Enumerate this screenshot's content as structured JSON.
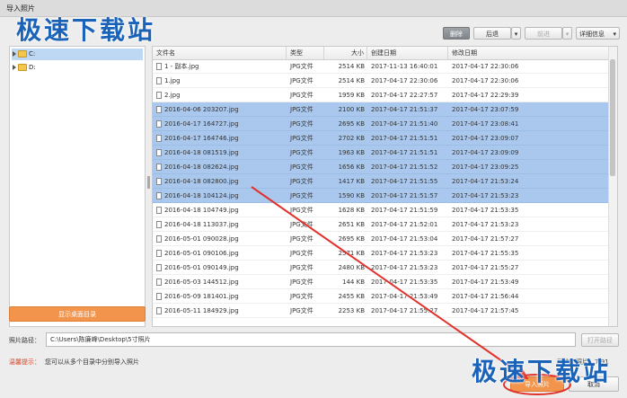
{
  "window": {
    "title": "导入照片"
  },
  "watermark": {
    "text": "极速下载站"
  },
  "toolbar": {
    "delete_label": "删除",
    "back_label": "后退",
    "forward_label": "前进",
    "details_label": "详细信息"
  },
  "tree": {
    "items": [
      {
        "label": "C:",
        "selected": true
      },
      {
        "label": "D:",
        "selected": false
      }
    ],
    "show_desktop_label": "显示桌面目录"
  },
  "table": {
    "columns": [
      "文件名",
      "类型",
      "大小",
      "创建日期",
      "修改日期"
    ],
    "rows": [
      {
        "name": "1 - 副本.jpg",
        "type": "JPG文件",
        "size": "2514 KB",
        "created": "2017-11-13 16:40:01",
        "modified": "2017-04-17 22:30:06",
        "selected": false
      },
      {
        "name": "1.jpg",
        "type": "JPG文件",
        "size": "2514 KB",
        "created": "2017-04-17 22:30:06",
        "modified": "2017-04-17 22:30:06",
        "selected": false
      },
      {
        "name": "2.jpg",
        "type": "JPG文件",
        "size": "1959 KB",
        "created": "2017-04-17 22:27:57",
        "modified": "2017-04-17 22:29:39",
        "selected": false
      },
      {
        "name": "2016-04-06 203207.jpg",
        "type": "JPG文件",
        "size": "2100 KB",
        "created": "2017-04-17 21:51:37",
        "modified": "2017-04-17 23:07:59",
        "selected": true
      },
      {
        "name": "2016-04-17 164727.jpg",
        "type": "JPG文件",
        "size": "2695 KB",
        "created": "2017-04-17 21:51:40",
        "modified": "2017-04-17 23:08:41",
        "selected": true
      },
      {
        "name": "2016-04-17 164746.jpg",
        "type": "JPG文件",
        "size": "2702 KB",
        "created": "2017-04-17 21:51:51",
        "modified": "2017-04-17 23:09:07",
        "selected": true
      },
      {
        "name": "2016-04-18 081519.jpg",
        "type": "JPG文件",
        "size": "1963 KB",
        "created": "2017-04-17 21:51:51",
        "modified": "2017-04-17 23:09:09",
        "selected": true
      },
      {
        "name": "2016-04-18 082624.jpg",
        "type": "JPG文件",
        "size": "1656 KB",
        "created": "2017-04-17 21:51:52",
        "modified": "2017-04-17 23:09:25",
        "selected": true
      },
      {
        "name": "2016-04-18 082800.jpg",
        "type": "JPG文件",
        "size": "1417 KB",
        "created": "2017-04-17 21:51:55",
        "modified": "2017-04-17 21:53:24",
        "selected": true
      },
      {
        "name": "2016-04-18 104124.jpg",
        "type": "JPG文件",
        "size": "1590 KB",
        "created": "2017-04-17 21:51:57",
        "modified": "2017-04-17 21:53:23",
        "selected": true
      },
      {
        "name": "2016-04-18 104749.jpg",
        "type": "JPG文件",
        "size": "1628 KB",
        "created": "2017-04-17 21:51:59",
        "modified": "2017-04-17 21:53:35",
        "selected": false
      },
      {
        "name": "2016-04-18 113037.jpg",
        "type": "JPG文件",
        "size": "2651 KB",
        "created": "2017-04-17 21:52:01",
        "modified": "2017-04-17 21:53:23",
        "selected": false
      },
      {
        "name": "2016-05-01 090028.jpg",
        "type": "JPG文件",
        "size": "2695 KB",
        "created": "2017-04-17 21:53:04",
        "modified": "2017-04-17 21:57:27",
        "selected": false
      },
      {
        "name": "2016-05-01 090106.jpg",
        "type": "JPG文件",
        "size": "2571 KB",
        "created": "2017-04-17 21:53:23",
        "modified": "2017-04-17 21:55:35",
        "selected": false
      },
      {
        "name": "2016-05-01 090149.jpg",
        "type": "JPG文件",
        "size": "2480 KB",
        "created": "2017-04-17 21:53:23",
        "modified": "2017-04-17 21:55:27",
        "selected": false
      },
      {
        "name": "2016-05-03 144512.jpg",
        "type": "JPG文件",
        "size": "144 KB",
        "created": "2017-04-17 21:53:35",
        "modified": "2017-04-17 21:53:49",
        "selected": false
      },
      {
        "name": "2016-05-09 181401.jpg",
        "type": "JPG文件",
        "size": "2455 KB",
        "created": "2017-04-17 21:53:49",
        "modified": "2017-04-17 21:56:44",
        "selected": false
      },
      {
        "name": "2016-05-11 184929.jpg",
        "type": "JPG文件",
        "size": "2253 KB",
        "created": "2017-04-17 21:55:27",
        "modified": "2017-04-17 21:57:45",
        "selected": false
      }
    ]
  },
  "footer": {
    "path_label": "照片路径：",
    "path_value": "C:\\Users\\陈廉峰\\Desktop\\5寸照片",
    "open_path_label": "打开路径",
    "tip_label": "温馨提示：",
    "tip_text": "您可以从多个目录中分别导入照片",
    "selected_count": "已选中照片：7/91",
    "import_label": "导入照片",
    "cancel_label": "取消"
  },
  "colors": {
    "selection": "#aac8ee",
    "accent_orange": "#f3944c",
    "annotation_red": "#e0312a",
    "watermark_blue": "#1a63b8"
  }
}
